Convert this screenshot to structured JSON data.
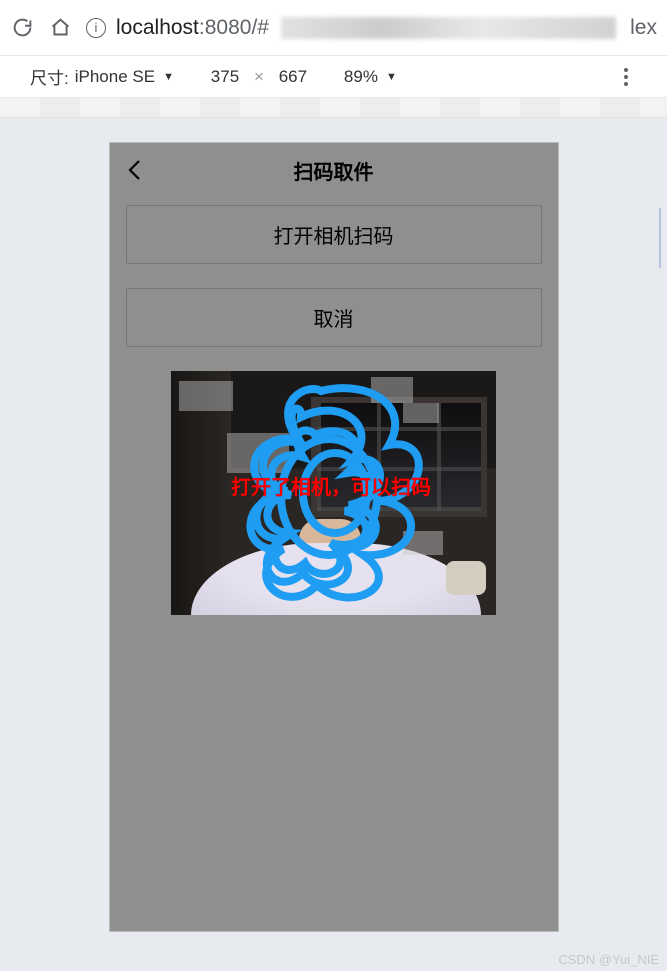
{
  "browser": {
    "url_host": "localhost",
    "url_port": ":8080/#",
    "url_suffix": "lex"
  },
  "device_bar": {
    "size_label": "尺寸:",
    "device_name": "iPhone SE",
    "width": "375",
    "height": "667",
    "separator": "×",
    "zoom": "89%"
  },
  "app": {
    "title": "扫码取件",
    "open_camera_label": "打开相机扫码",
    "cancel_label": "取消",
    "overlay_text": "打开了相机，可以扫码"
  },
  "watermark": "CSDN @Yui_NIE"
}
